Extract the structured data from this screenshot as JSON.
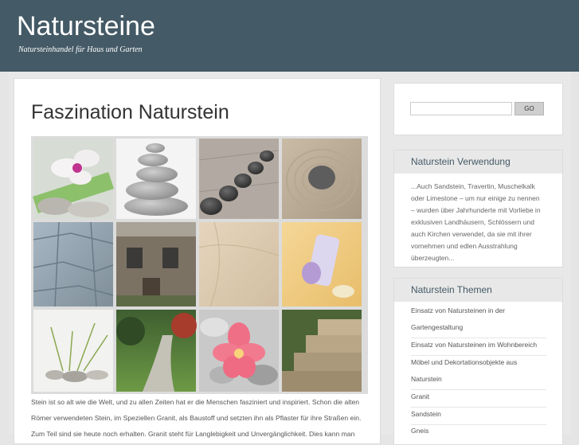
{
  "header": {
    "title": "Natursteine",
    "tagline": "Natursteinhandel für Haus und Garten"
  },
  "post": {
    "title": "Faszination Naturstein",
    "body_lines": [
      "Stein ist so alt wie die Welt, und zu allen Zeiten hat er die Menschen fasziniert und inspiriert. Schon die alten",
      "Römer verwendeten Stein, im Speziellen Granit, als Baustoff und setzten ihn als Pflaster für ihre Straßen ein.",
      "Zum Teil sind sie heute noch erhalten. Granit steht für Langlebigkeit und Unvergänglichkeit. Dies kann man"
    ]
  },
  "gallery": {
    "images": [
      {
        "name": "orchid-stones-image",
        "alt": "Orchidee auf Steinen"
      },
      {
        "name": "stacked-pebbles-image",
        "alt": "Gestapelte Kieselsteine"
      },
      {
        "name": "dark-stones-row-image",
        "alt": "Dunkle Steine auf Holz"
      },
      {
        "name": "zen-sand-stone-image",
        "alt": "Stein im Zen-Sand"
      },
      {
        "name": "slate-wall-image",
        "alt": "Schiefermauer"
      },
      {
        "name": "stone-house-image",
        "alt": "Steinhaus"
      },
      {
        "name": "marble-texture-image",
        "alt": "Marmor"
      },
      {
        "name": "bath-products-image",
        "alt": "Badeprodukte"
      },
      {
        "name": "grass-pebbles-image",
        "alt": "Gras und Kiesel"
      },
      {
        "name": "garden-path-image",
        "alt": "Gartenweg"
      },
      {
        "name": "frangipani-pebbles-image",
        "alt": "Frangipani auf Kieseln"
      },
      {
        "name": "stone-steps-image",
        "alt": "Steintreppe"
      }
    ]
  },
  "search": {
    "placeholder": "",
    "button_label": "GO"
  },
  "widget_usage": {
    "title": "Naturstein Verwendung",
    "lines": [
      "...Auch Sandstein, Travertin, Muschelkalk",
      "oder Limestone – um nur einige zu nennen",
      "– wurden über Jahrhunderte mit Vorliebe in",
      "exklusiven Landhäusern, Schlössern und",
      "auch Kirchen verwendet, da sie mit ihrer",
      "vornehmen und edlen Ausstrahlung",
      "überzeugten..."
    ]
  },
  "widget_topics": {
    "title": "Naturstein Themen",
    "items": [
      "Einsatz von Natursteinen in der",
      "Gartengestaltung",
      "Einsatz von Natursteinen im Wohnbereich",
      "Möbel und Dekortationsobjekte aus",
      "Naturstein",
      "Granit",
      "Sandstein",
      "Gneis"
    ]
  },
  "colors": {
    "header_bg": "#445a66",
    "widget_title_color": "#445a66"
  }
}
